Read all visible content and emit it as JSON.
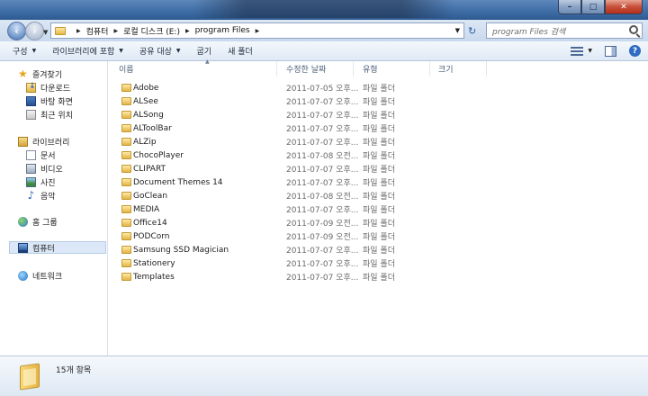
{
  "window": {
    "caption_buttons": {
      "minimize": "–",
      "maximize": "□",
      "close": "✕"
    }
  },
  "address": {
    "path": [
      "컴퓨터",
      "로컬 디스크 (E:)",
      "program Files"
    ],
    "search_placeholder": "program Files 검색"
  },
  "toolbar": {
    "organize": "구성",
    "include_library": "라이브러리에 포함",
    "share": "공유 대상",
    "burn": "굽기",
    "new_folder": "새 폴더"
  },
  "sidebar": {
    "favorites": {
      "label": "즐겨찾기",
      "items": [
        "다운로드",
        "바탕 화면",
        "최근 위치"
      ]
    },
    "libraries": {
      "label": "라이브러리",
      "items": [
        "문서",
        "비디오",
        "사진",
        "음악"
      ]
    },
    "homegroup": "홈 그룹",
    "computer": "컴퓨터",
    "network": "네트워크"
  },
  "columns": {
    "name": "이름",
    "date": "수정한 날짜",
    "type": "유형",
    "size": "크기"
  },
  "files": [
    {
      "name": "Adobe",
      "date": "2011-07-05 오후...",
      "type": "파일 폴더"
    },
    {
      "name": "ALSee",
      "date": "2011-07-07 오후...",
      "type": "파일 폴더"
    },
    {
      "name": "ALSong",
      "date": "2011-07-07 오후...",
      "type": "파일 폴더"
    },
    {
      "name": "ALToolBar",
      "date": "2011-07-07 오후...",
      "type": "파일 폴더"
    },
    {
      "name": "ALZip",
      "date": "2011-07-07 오후...",
      "type": "파일 폴더"
    },
    {
      "name": "ChocoPlayer",
      "date": "2011-07-08 오전...",
      "type": "파일 폴더"
    },
    {
      "name": "CLIPART",
      "date": "2011-07-07 오후...",
      "type": "파일 폴더"
    },
    {
      "name": "Document Themes 14",
      "date": "2011-07-07 오후...",
      "type": "파일 폴더"
    },
    {
      "name": "GoClean",
      "date": "2011-07-08 오전...",
      "type": "파일 폴더"
    },
    {
      "name": "MEDIA",
      "date": "2011-07-07 오후...",
      "type": "파일 폴더"
    },
    {
      "name": "Office14",
      "date": "2011-07-09 오전...",
      "type": "파일 폴더"
    },
    {
      "name": "PODCorn",
      "date": "2011-07-09 오전...",
      "type": "파일 폴더"
    },
    {
      "name": "Samsung SSD Magician",
      "date": "2011-07-07 오후...",
      "type": "파일 폴더"
    },
    {
      "name": "Stationery",
      "date": "2011-07-07 오후...",
      "type": "파일 폴더"
    },
    {
      "name": "Templates",
      "date": "2011-07-07 오후...",
      "type": "파일 폴더"
    }
  ],
  "details": {
    "item_count": "15개 항목"
  }
}
